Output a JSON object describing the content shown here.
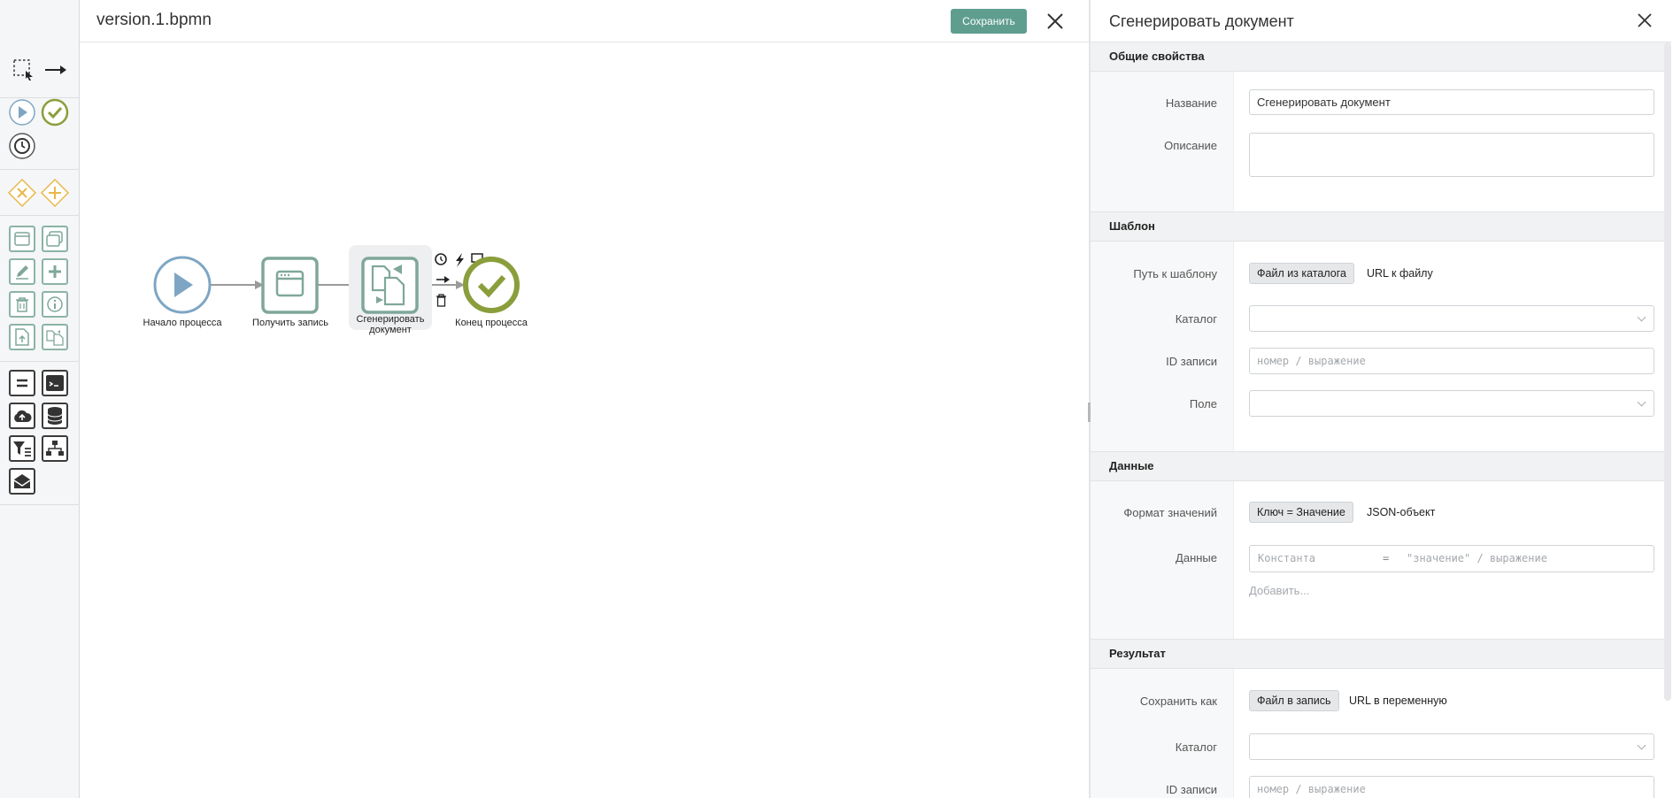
{
  "editor": {
    "file_name": "version.1.bpmn",
    "save_label": "Сохранить"
  },
  "palette": {
    "tools": [
      "lasso-tool",
      "connect-tool"
    ],
    "events": [
      "start-event",
      "end-event",
      "timer-event"
    ],
    "gateways": [
      "exclusive-gateway",
      "parallel-gateway"
    ],
    "tasks": [
      "user-task",
      "subprocess",
      "edit-record",
      "create-record",
      "delete-record",
      "info",
      "upload-file",
      "generate-document"
    ],
    "services": [
      "assign",
      "script",
      "cloud-upload",
      "database",
      "filter",
      "hierarchy",
      "send-mail"
    ]
  },
  "diagram": {
    "nodes": [
      {
        "id": "start",
        "label": "Начало процесса"
      },
      {
        "id": "get-record",
        "label": "Получить запись"
      },
      {
        "id": "generate",
        "label": "Сгенерировать документ"
      },
      {
        "id": "end",
        "label": "Конец процесса"
      }
    ]
  },
  "panel": {
    "title": "Сгенерировать документ",
    "general": {
      "header": "Общие свойства",
      "name_label": "Название",
      "name_value": "Сгенерировать документ",
      "desc_label": "Описание",
      "desc_value": ""
    },
    "template": {
      "header": "Шаблон",
      "path_label": "Путь к шаблону",
      "path_opt1": "Файл из каталога",
      "path_opt2": "URL к файлу",
      "catalog_label": "Каталог",
      "record_label": "ID записи",
      "record_placeholder": "номер / выражение",
      "field_label": "Поле"
    },
    "data": {
      "header": "Данные",
      "format_label": "Формат значений",
      "format_opt1": "Ключ = Значение",
      "format_opt2": "JSON-объект",
      "data_label": "Данные",
      "key_placeholder": "Константа",
      "eq": "=",
      "value_placeholder": "\"значение\" / выражение",
      "add_label": "Добавить..."
    },
    "result": {
      "header": "Результат",
      "save_label": "Сохранить как",
      "save_opt1": "Файл в запись",
      "save_opt2": "URL в переменную",
      "catalog_label": "Каталог",
      "record_label": "ID записи",
      "record_placeholder": "номер / выражение"
    }
  },
  "colors": {
    "accent": "#5f9e8f",
    "task": "#7fa79a",
    "start": "#7ea6c4",
    "end": "#8a9e3c"
  }
}
